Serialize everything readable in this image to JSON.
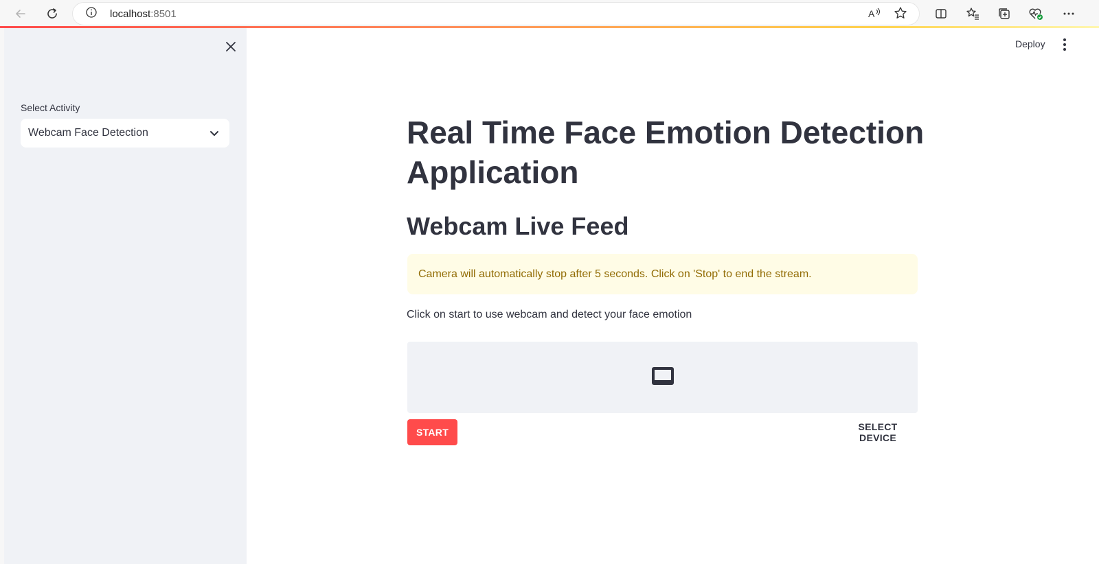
{
  "browser": {
    "url_host": "localhost",
    "url_port": ":8501",
    "icons": [
      "back-arrow-icon",
      "refresh-icon",
      "info-icon",
      "read-aloud-icon",
      "favorite-star-icon",
      "split-screen-icon",
      "favorites-list-icon",
      "collections-icon",
      "browser-essentials-icon",
      "more-icon"
    ]
  },
  "sidebar": {
    "select_label": "Select Activity",
    "select_value": "Webcam Face Detection"
  },
  "header": {
    "deploy_label": "Deploy"
  },
  "main": {
    "title": "Real Time Face Emotion Detection Application",
    "subtitle": "Webcam Live Feed",
    "warning": "Camera will automatically stop after 5 seconds. Click on 'Stop' to end the stream.",
    "description": "Click on start to use webcam and detect your face emotion",
    "start_label": "START",
    "select_device_label": "SELECT DEVICE"
  },
  "colors": {
    "accent": "#ff4b4b",
    "sidebar_bg": "#f0f2f6",
    "warning_bg": "#fffce6",
    "warning_text": "#926c05",
    "text": "#31333f"
  }
}
